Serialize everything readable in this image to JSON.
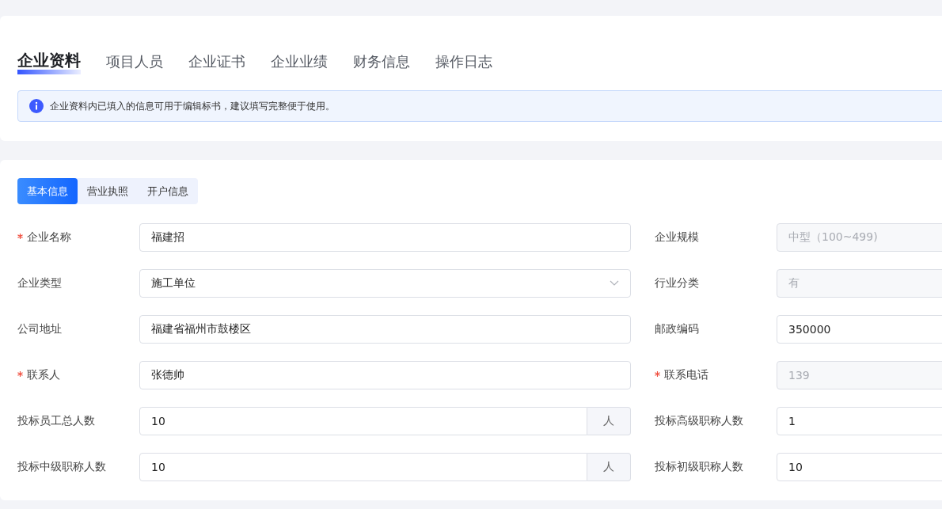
{
  "tabs": [
    {
      "label": "企业资料",
      "selected": true
    },
    {
      "label": "项目人员",
      "selected": false
    },
    {
      "label": "企业证书",
      "selected": false
    },
    {
      "label": "企业业绩",
      "selected": false
    },
    {
      "label": "财务信息",
      "selected": false
    },
    {
      "label": "操作日志",
      "selected": false
    }
  ],
  "notice": {
    "text": "企业资料内已填入的信息可用于编辑标书，建议填写完整便于使用。"
  },
  "sub_tabs": [
    {
      "label": "基本信息",
      "selected": true
    },
    {
      "label": "营业执照",
      "selected": false
    },
    {
      "label": "开户信息",
      "selected": false
    }
  ],
  "fields": [
    {
      "label": "企业名称",
      "required": true,
      "kind": "text",
      "value": "福建招",
      "disabled": false
    },
    {
      "label": "企业规模",
      "required": false,
      "kind": "text",
      "value": "中型（100~499)",
      "disabled": true
    },
    {
      "label": "企业类型",
      "required": false,
      "kind": "select",
      "value": "施工单位",
      "disabled": false
    },
    {
      "label": "行业分类",
      "required": false,
      "kind": "text",
      "value": "有",
      "disabled": true
    },
    {
      "label": "公司地址",
      "required": false,
      "kind": "text",
      "value": "福建省福州市鼓楼区",
      "disabled": false
    },
    {
      "label": "邮政编码",
      "required": false,
      "kind": "text",
      "value": "350000",
      "disabled": false
    },
    {
      "label": "联系人",
      "required": true,
      "kind": "text",
      "value": "张德帅",
      "disabled": false
    },
    {
      "label": "联系电话",
      "required": true,
      "kind": "text",
      "value": "139",
      "disabled": true
    },
    {
      "label": "投标员工总人数",
      "required": false,
      "kind": "unit",
      "value": "10",
      "unit": "人"
    },
    {
      "label": "投标高级职称人数",
      "required": false,
      "kind": "text",
      "value": "1",
      "disabled": false
    },
    {
      "label": "投标中级职称人数",
      "required": false,
      "kind": "unit",
      "value": "10",
      "unit": "人"
    },
    {
      "label": "投标初级职称人数",
      "required": false,
      "kind": "text",
      "value": "10",
      "disabled": false
    }
  ]
}
